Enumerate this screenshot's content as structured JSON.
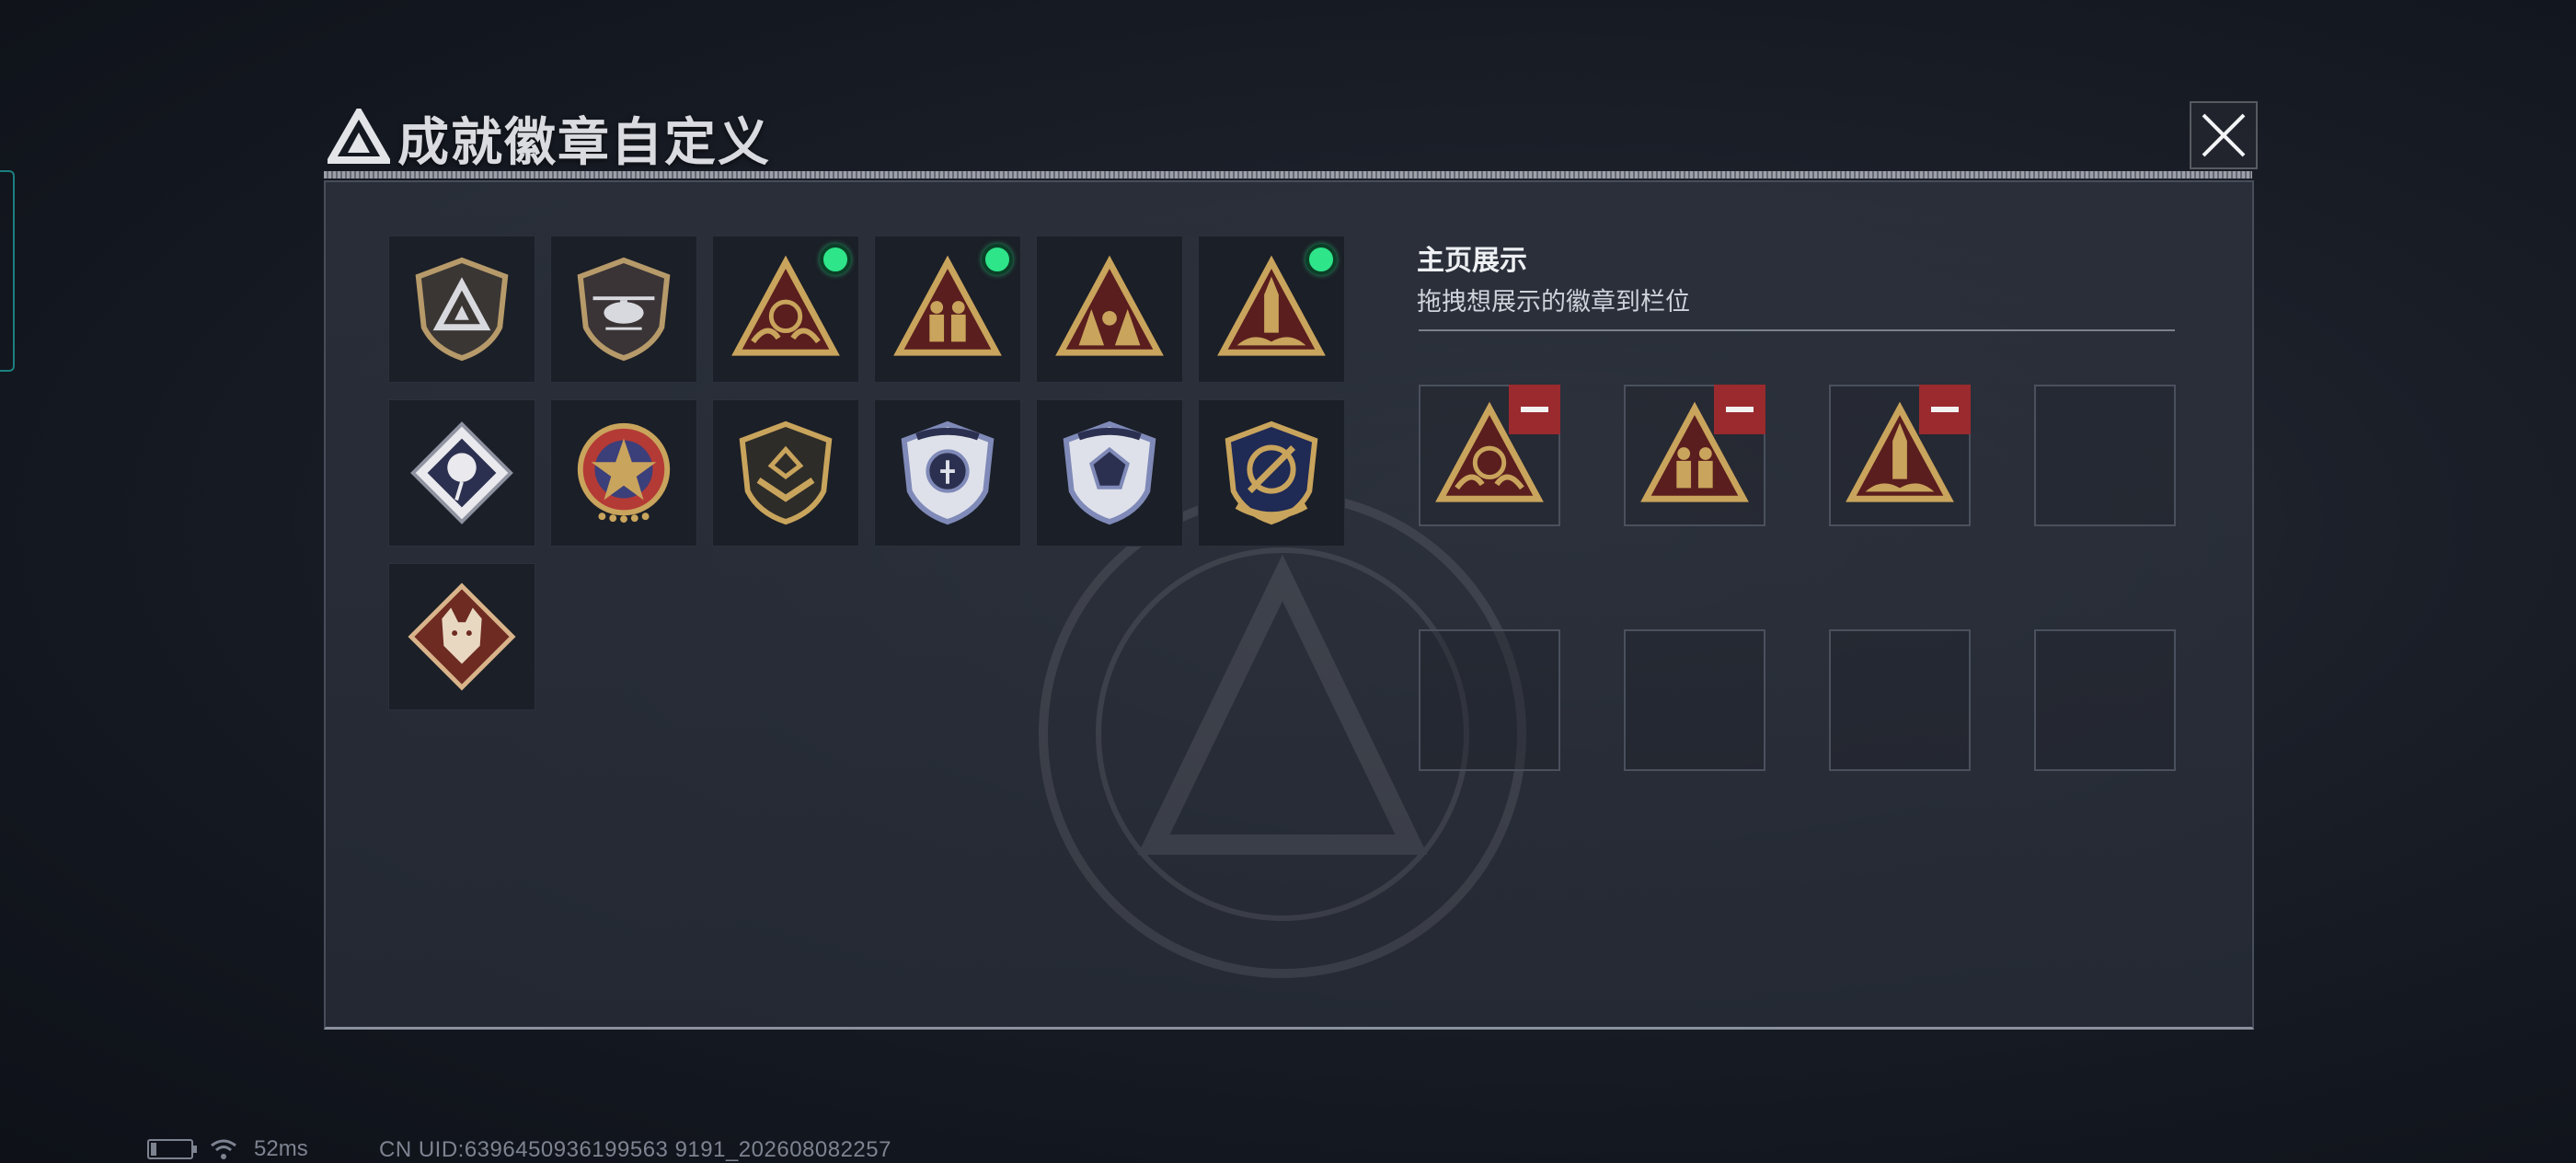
{
  "dialog": {
    "title": "成就徽章自定义",
    "close_label": "×"
  },
  "badge_inventory": [
    {
      "icon": "faction-logo-shield-badge",
      "equipped": false
    },
    {
      "icon": "helicopter-shield-badge",
      "equipped": false
    },
    {
      "icon": "gold-triangle-hands-badge",
      "equipped": true
    },
    {
      "icon": "gold-triangle-soldiers-badge",
      "equipped": true
    },
    {
      "icon": "gold-triangle-lions-badge",
      "equipped": false
    },
    {
      "icon": "gold-triangle-rocket-badge",
      "equipped": true
    },
    {
      "icon": "silver-rose-diamond-badge",
      "equipped": false
    },
    {
      "icon": "red-star-medal-badge",
      "equipped": false
    },
    {
      "icon": "gold-shield-chevron-badge",
      "equipped": false
    },
    {
      "icon": "blue-winged-shield-badge",
      "equipped": false
    },
    {
      "icon": "blue-winged-gem-badge",
      "equipped": false
    },
    {
      "icon": "gold-crest-emblem-badge",
      "equipped": false
    },
    {
      "icon": "wolf-head-diamond-badge",
      "equipped": false
    }
  ],
  "homepage_display": {
    "title": "主页展示",
    "subtitle": "拖拽想展示的徽章到栏位",
    "slots": [
      {
        "badge": "gold-triangle-hands-badge"
      },
      {
        "badge": "gold-triangle-soldiers-badge"
      },
      {
        "badge": "gold-triangle-rocket-badge"
      },
      {
        "badge": null
      },
      {
        "badge": null
      },
      {
        "badge": null
      },
      {
        "badge": null
      },
      {
        "badge": null
      }
    ]
  },
  "status_bar": {
    "ping": "52ms",
    "uid": "CN UID:6396450936199563 9191_202608082257"
  },
  "colors": {
    "equipped_indicator": "#2ee58a",
    "remove_button": "#9a2a2e",
    "badge_gold": "#c9a45c"
  }
}
